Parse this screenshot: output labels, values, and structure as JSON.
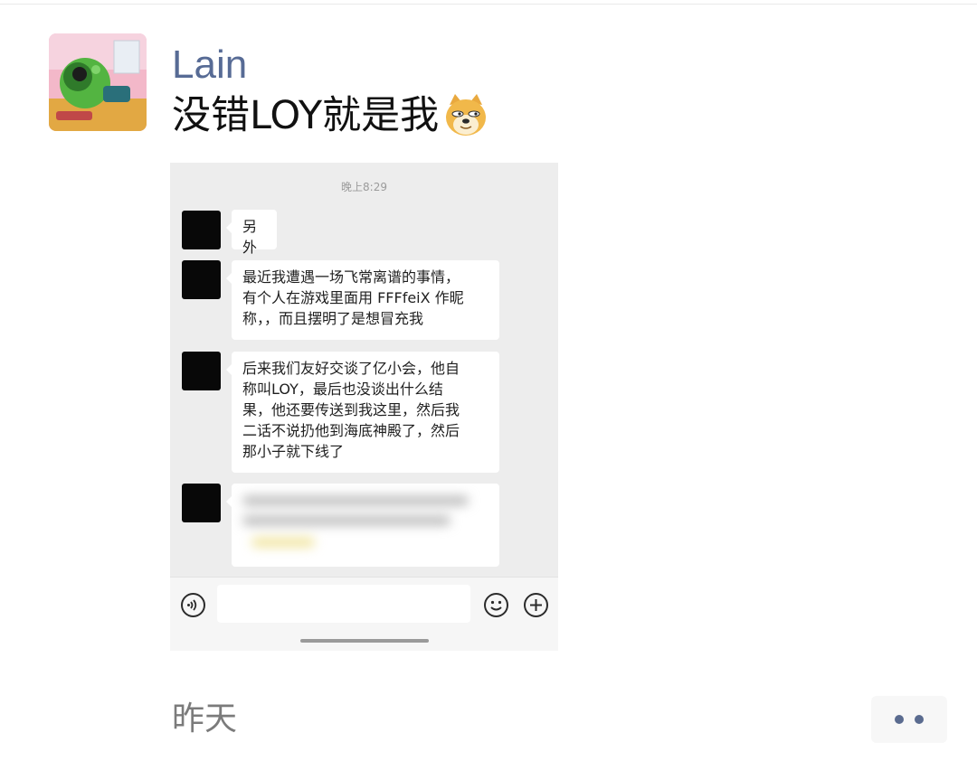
{
  "post": {
    "author": "Lain",
    "text": "没错LOY就是我",
    "emoji": "doge-emoji",
    "time": "昨天"
  },
  "screenshot": {
    "time": "晚上8:29",
    "messages": [
      {
        "text": "另外"
      },
      {
        "text": "最近我遭遇一场飞常离谱的事情，\n有个人在游戏里面用 FFFfeiX 作昵\n称，，而且摆明了是想冒充我"
      },
      {
        "text": "后来我们友好交谈了亿小会，他自\n称叫LOY，最后也没谈出什么结\n果，他还要传送到我这里，然后我\n二话不说扔他到海底神殿了，然后\n那小子就下线了"
      },
      {
        "text": ""
      }
    ],
    "input_icons": [
      "voice-icon",
      "emoji-icon",
      "plus-icon"
    ]
  },
  "icons": {
    "more": "more-dots-icon"
  },
  "colors": {
    "author": "#576b95",
    "background": "#ffffff",
    "dots": "#5a6b8f"
  }
}
